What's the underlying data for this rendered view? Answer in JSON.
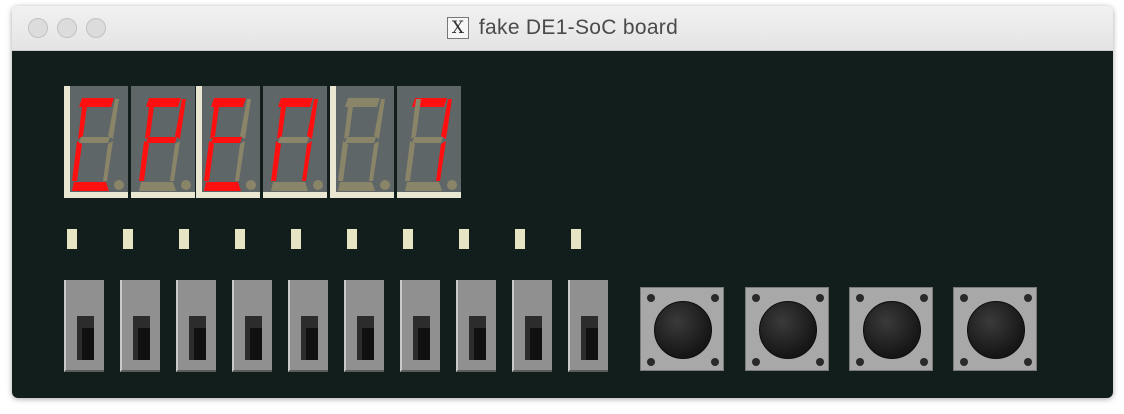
{
  "window": {
    "title": "fake DE1-SoC board"
  },
  "hex_displays": [
    {
      "name": "HEX5",
      "char": "C",
      "segments_on": [
        "a",
        "d",
        "e",
        "f"
      ],
      "dp_on": false
    },
    {
      "name": "HEX4",
      "char": "P",
      "segments_on": [
        "a",
        "b",
        "e",
        "f",
        "g"
      ],
      "dp_on": false
    },
    {
      "name": "HEX3",
      "char": "E",
      "segments_on": [
        "a",
        "d",
        "e",
        "f",
        "g"
      ],
      "dp_on": false
    },
    {
      "name": "HEX2",
      "char": "n",
      "segments_on": [
        "a",
        "b",
        "c",
        "e",
        "f"
      ],
      "dp_on": false
    },
    {
      "name": "HEX1",
      "char": "",
      "segments_on": [],
      "dp_on": false
    },
    {
      "name": "HEX0",
      "char": "7",
      "segments_on": [
        "a",
        "b",
        "c"
      ],
      "dp_on": false
    }
  ],
  "leds": [
    {
      "index": 9,
      "on": false
    },
    {
      "index": 8,
      "on": false
    },
    {
      "index": 7,
      "on": false
    },
    {
      "index": 6,
      "on": false
    },
    {
      "index": 5,
      "on": false
    },
    {
      "index": 4,
      "on": false
    },
    {
      "index": 3,
      "on": false
    },
    {
      "index": 2,
      "on": false
    },
    {
      "index": 1,
      "on": false
    },
    {
      "index": 0,
      "on": false
    }
  ],
  "switches": [
    {
      "index": 9,
      "state": "down"
    },
    {
      "index": 8,
      "state": "down"
    },
    {
      "index": 7,
      "state": "down"
    },
    {
      "index": 6,
      "state": "down"
    },
    {
      "index": 5,
      "state": "down"
    },
    {
      "index": 4,
      "state": "down"
    },
    {
      "index": 3,
      "state": "down"
    },
    {
      "index": 2,
      "state": "down"
    },
    {
      "index": 1,
      "state": "down"
    },
    {
      "index": 0,
      "state": "down"
    }
  ],
  "buttons": [
    {
      "index": 3,
      "pressed": false
    },
    {
      "index": 2,
      "pressed": false
    },
    {
      "index": 1,
      "pressed": false
    },
    {
      "index": 0,
      "pressed": false
    }
  ],
  "colors": {
    "segment_on": "#ff1010",
    "segment_off": "#8a8568",
    "background": "#121e1c"
  }
}
